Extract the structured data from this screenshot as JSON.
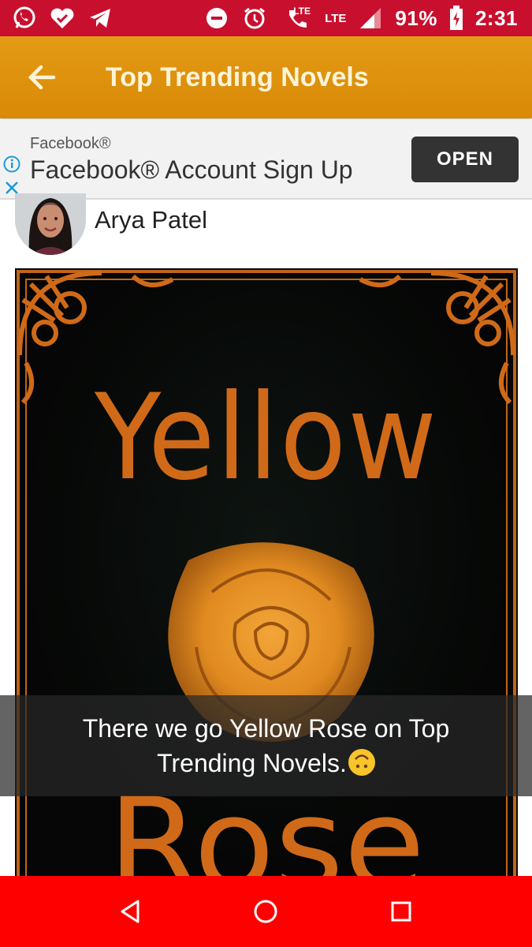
{
  "status_bar": {
    "battery": "91%",
    "time": "2:31",
    "network_1": "LTE",
    "network_2": "LTE",
    "left_icons": [
      "whatsapp-icon",
      "heart-check-icon",
      "telegram-icon"
    ],
    "right_icons": [
      "do-not-disturb-icon",
      "alarm-icon",
      "volte-call-icon",
      "signal-icon",
      "battery-charging-icon"
    ]
  },
  "app_bar": {
    "title": "Top Trending Novels",
    "back_icon": "arrow-left-icon",
    "color": "#dd8f0c"
  },
  "ad": {
    "advertiser": "Facebook®",
    "headline": "Facebook® Account Sign Up",
    "button_label": "OPEN"
  },
  "post": {
    "author_name": "Arya Patel"
  },
  "cover": {
    "title_top": "Yellow",
    "title_bottom": "Rose",
    "accent_color": "#d06a18"
  },
  "caption": {
    "text": "There we go Yellow Rose on Top Trending Novels.",
    "emoji": "upside-down-face-emoji"
  },
  "nav_bar": {
    "color": "#ff0000",
    "buttons": [
      "back-triangle-icon",
      "home-circle-icon",
      "recents-square-icon"
    ]
  }
}
